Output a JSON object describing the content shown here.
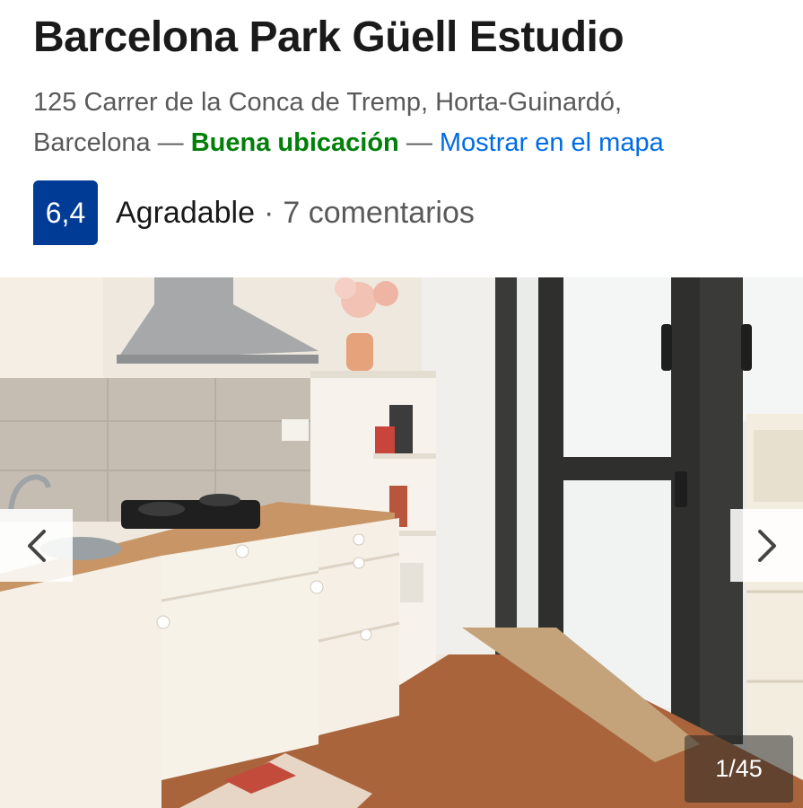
{
  "hotel": {
    "name": "Barcelona Park Güell Estudio",
    "address_line1": "125 Carrer de la Conca de Tremp, Horta-Guinardó,",
    "address_city": "Barcelona",
    "dash1": "—",
    "location_badge": "Buena ubicación",
    "dash2": "—",
    "map_link": "Mostrar en el mapa"
  },
  "rating": {
    "score": "6,4",
    "label": "Agradable",
    "separator": "·",
    "reviews": "7 comentarios"
  },
  "gallery": {
    "counter": "1/45",
    "prev_icon": "chevron-left-icon",
    "next_icon": "chevron-right-icon"
  },
  "colors": {
    "score_bg": "#003b95",
    "good_location": "#008009",
    "link": "#006ce4"
  }
}
